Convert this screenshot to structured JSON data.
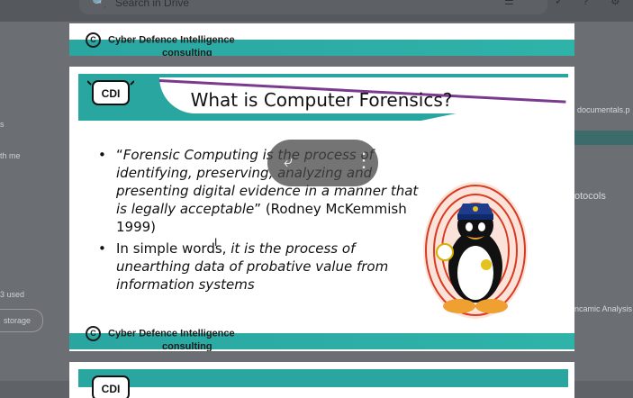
{
  "drive": {
    "search_placeholder": "Search in Drive",
    "left_labels": {
      "s": "s",
      "with_me": "th me",
      "used": "3 used",
      "storage_button": "storage"
    },
    "right_labels": {
      "documentals": "documentals.p",
      "protocols": "otocols",
      "analysis": "ncamic Analysis"
    }
  },
  "slides": {
    "header_slide": {
      "brand_line1": "Cyber Defence  Intelligence",
      "brand_line2": "consulting"
    },
    "main_slide": {
      "title": "What is Computer Forensics?",
      "bullet1_open_quote": "“",
      "bullet1_italic": "Forensic Computing is the process of identifying, preserving, analyzing and presenting digital evidence in a manner that is legally acceptable",
      "bullet1_tail": "” (Rodney McKemmish 1999)",
      "bullet2_plain": "In simple words, ",
      "bullet2_italic": "it is the process of unearthing data of probative value from information systems",
      "footer_brand_line1": "Cyber Defence  Intelligence",
      "footer_brand_line2": "consulting"
    }
  },
  "colors": {
    "teal": "#2aa6a1",
    "purple": "#7a3b8f"
  }
}
